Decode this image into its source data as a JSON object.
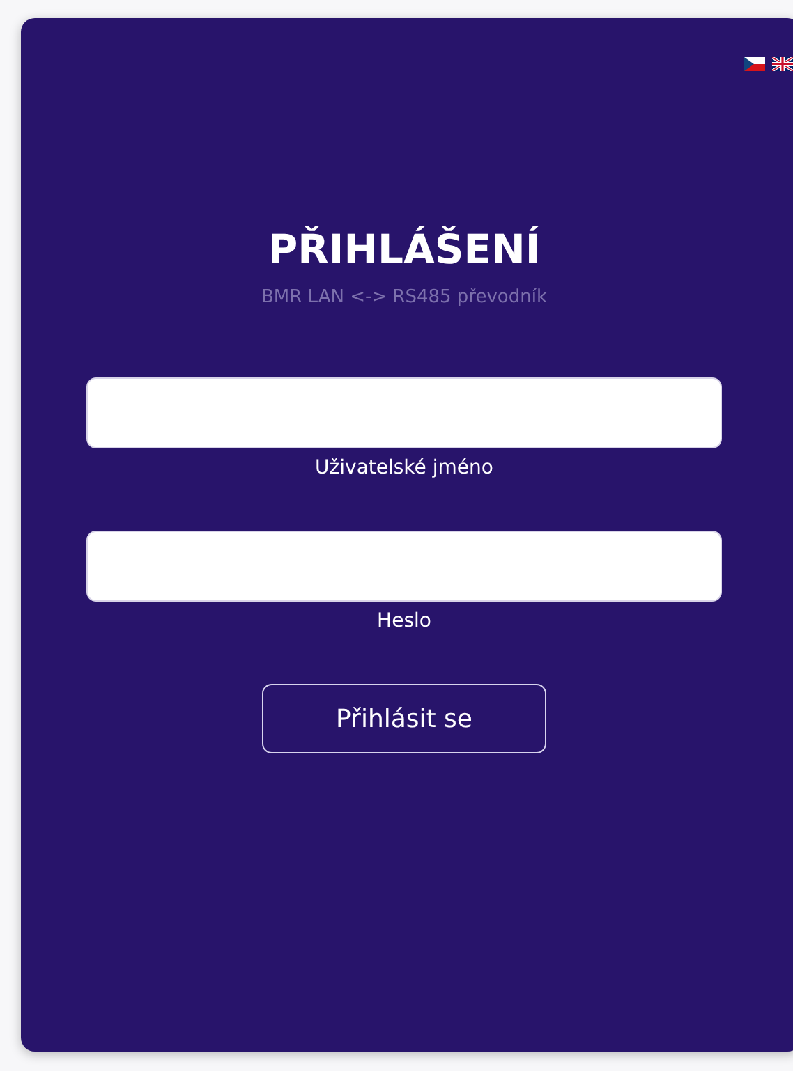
{
  "title": "PŘIHLÁŠENÍ",
  "subtitle": "BMR LAN <-> RS485 převodník",
  "fields": [
    {
      "label": "Uživatelské jméno"
    },
    {
      "label": "Heslo"
    }
  ],
  "submit_button": "Přihlásit se"
}
